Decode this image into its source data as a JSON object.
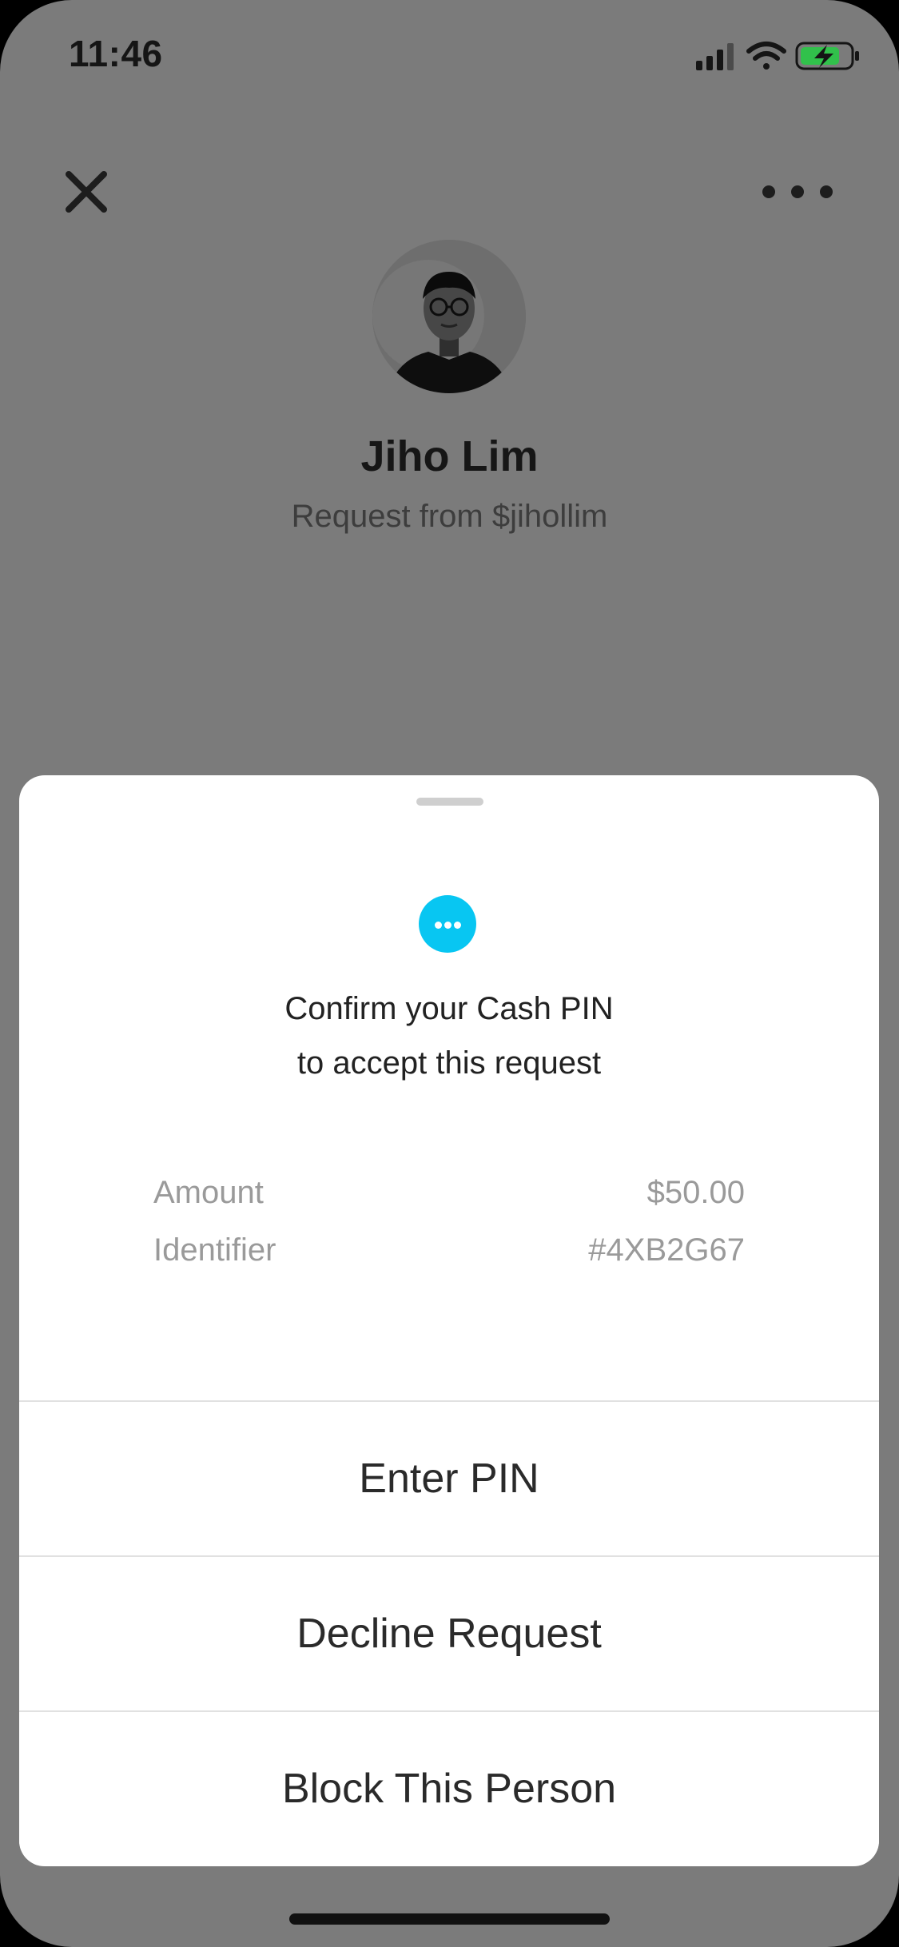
{
  "status_bar": {
    "time": "11:46",
    "signal_icon": "cellular-signal-icon",
    "wifi_icon": "wifi-icon",
    "battery_icon": "battery-charging-icon"
  },
  "header": {
    "close_icon": "close-icon",
    "more_icon": "more-horizontal-icon"
  },
  "profile": {
    "name": "Jiho Lim",
    "subtitle": "Request from $jihollim",
    "avatar_icon": "avatar-photo"
  },
  "sheet": {
    "info_icon": "more-circle-icon",
    "accent_color": "#08c6f2",
    "message_line1": "Confirm your Cash PIN",
    "message_line2": "to accept this request",
    "details": [
      {
        "label": "Amount",
        "value": "$50.00"
      },
      {
        "label": "Identifier",
        "value": "#4XB2G67"
      }
    ],
    "actions": [
      {
        "label": "Enter PIN"
      },
      {
        "label": "Decline Request"
      },
      {
        "label": "Block This Person"
      }
    ]
  }
}
